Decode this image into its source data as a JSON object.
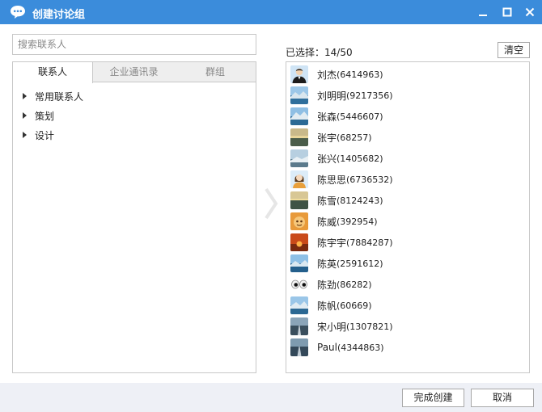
{
  "window": {
    "title": "创建讨论组"
  },
  "search": {
    "placeholder": "搜索联系人"
  },
  "tabs": [
    {
      "label": "联系人",
      "active": true
    },
    {
      "label": "企业通讯录",
      "active": false
    },
    {
      "label": "群组",
      "active": false
    }
  ],
  "tree": [
    {
      "label": "常用联系人"
    },
    {
      "label": "策划"
    },
    {
      "label": "设计"
    }
  ],
  "selection": {
    "label": "已选择：14/50",
    "clear_label": "清空",
    "items": [
      {
        "name": "刘杰",
        "id": "(6414963)",
        "avatar": "person-male-icon"
      },
      {
        "name": "刘明明",
        "id": "(9217356)",
        "avatar": "landscape-icon"
      },
      {
        "name": "张森",
        "id": "(5446607)",
        "avatar": "landscape-icon"
      },
      {
        "name": "张宇",
        "id": "(68257)",
        "avatar": "sunset-icon"
      },
      {
        "name": "张兴",
        "id": "(1405682)",
        "avatar": "landscape-icon"
      },
      {
        "name": "陈思思",
        "id": "(6736532)",
        "avatar": "person-female-icon"
      },
      {
        "name": "陈雪",
        "id": "(8124243)",
        "avatar": "sunset-icon"
      },
      {
        "name": "陈威",
        "id": "(392954)",
        "avatar": "cartoon-icon"
      },
      {
        "name": "陈宇宇",
        "id": "(7884287)",
        "avatar": "red-sunset-icon"
      },
      {
        "name": "陈英",
        "id": "(2591612)",
        "avatar": "landscape-icon"
      },
      {
        "name": "陈劲",
        "id": "(86282)",
        "avatar": "eyes-icon"
      },
      {
        "name": "陈帆",
        "id": "(60669)",
        "avatar": "landscape-icon"
      },
      {
        "name": "宋小明",
        "id": "(1307821)",
        "avatar": "road-icon"
      },
      {
        "name": "Paul",
        "id": "(4344863)",
        "avatar": "road-icon"
      }
    ]
  },
  "footer": {
    "create_label": "完成创建",
    "cancel_label": "取消"
  },
  "colors": {
    "titlebar": "#3b8cdb",
    "footer": "#eef0f6",
    "border": "#c8c8c8"
  }
}
